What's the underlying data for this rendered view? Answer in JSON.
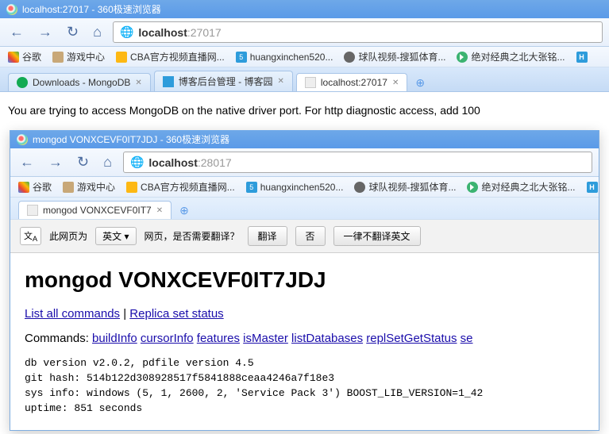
{
  "outer": {
    "title": "localhost:27017 - 360极速浏览器",
    "url_host": "localhost",
    "url_port": ":27017",
    "tabs": [
      {
        "label": "Downloads - MongoDB",
        "icon": "ic-mongo"
      },
      {
        "label": "博客后台管理 - 博客园",
        "icon": "ic-cnblogs"
      },
      {
        "label": "localhost:27017",
        "icon": "ic-blank",
        "active": true
      }
    ],
    "body_text": "You are trying to access MongoDB on the native driver port. For http diagnostic access, add 100"
  },
  "bookmarks": [
    {
      "label": "谷歌",
      "icon": "ic-g"
    },
    {
      "label": "游戏中心",
      "icon": "ic-game"
    },
    {
      "label": "CBA官方视频直播网...",
      "icon": "ic-cba"
    },
    {
      "label": "huangxinchen520...",
      "icon": "ic-hx",
      "glyph": "5"
    },
    {
      "label": "球队视频-搜狐体育...",
      "icon": "ic-person"
    },
    {
      "label": "绝对经典之北大张铭...",
      "icon": "ic-play"
    },
    {
      "label": "",
      "icon": "ic-h",
      "glyph": "H"
    }
  ],
  "inner": {
    "title": "mongod VONXCEVF0IT7JDJ - 360极速浏览器",
    "url_host": "localhost",
    "url_port": ":28017",
    "tab": {
      "label": "mongod VONXCEVF0IT7"
    },
    "translate": {
      "prompt_pre": "此网页为",
      "lang": "英文",
      "prompt_post": "网页，是否需要翻译？",
      "btn_translate": "翻译",
      "btn_no": "否",
      "btn_never": "一律不翻译英文"
    },
    "heading": "mongod VONXCEVF0IT7JDJ",
    "links": {
      "list_all": "List all commands",
      "replica": "Replica set status",
      "commands_label": "Commands:",
      "cmds": [
        "buildInfo",
        "cursorInfo",
        "features",
        "isMaster",
        "listDatabases",
        "replSetGetStatus",
        "se"
      ]
    },
    "info": [
      "db version v2.0.2, pdfile version 4.5",
      "git hash: 514b122d308928517f5841888ceaa4246a7f18e3",
      "sys info: windows (5, 1, 2600, 2, 'Service Pack 3') BOOST_LIB_VERSION=1_42",
      "uptime: 851 seconds"
    ]
  }
}
